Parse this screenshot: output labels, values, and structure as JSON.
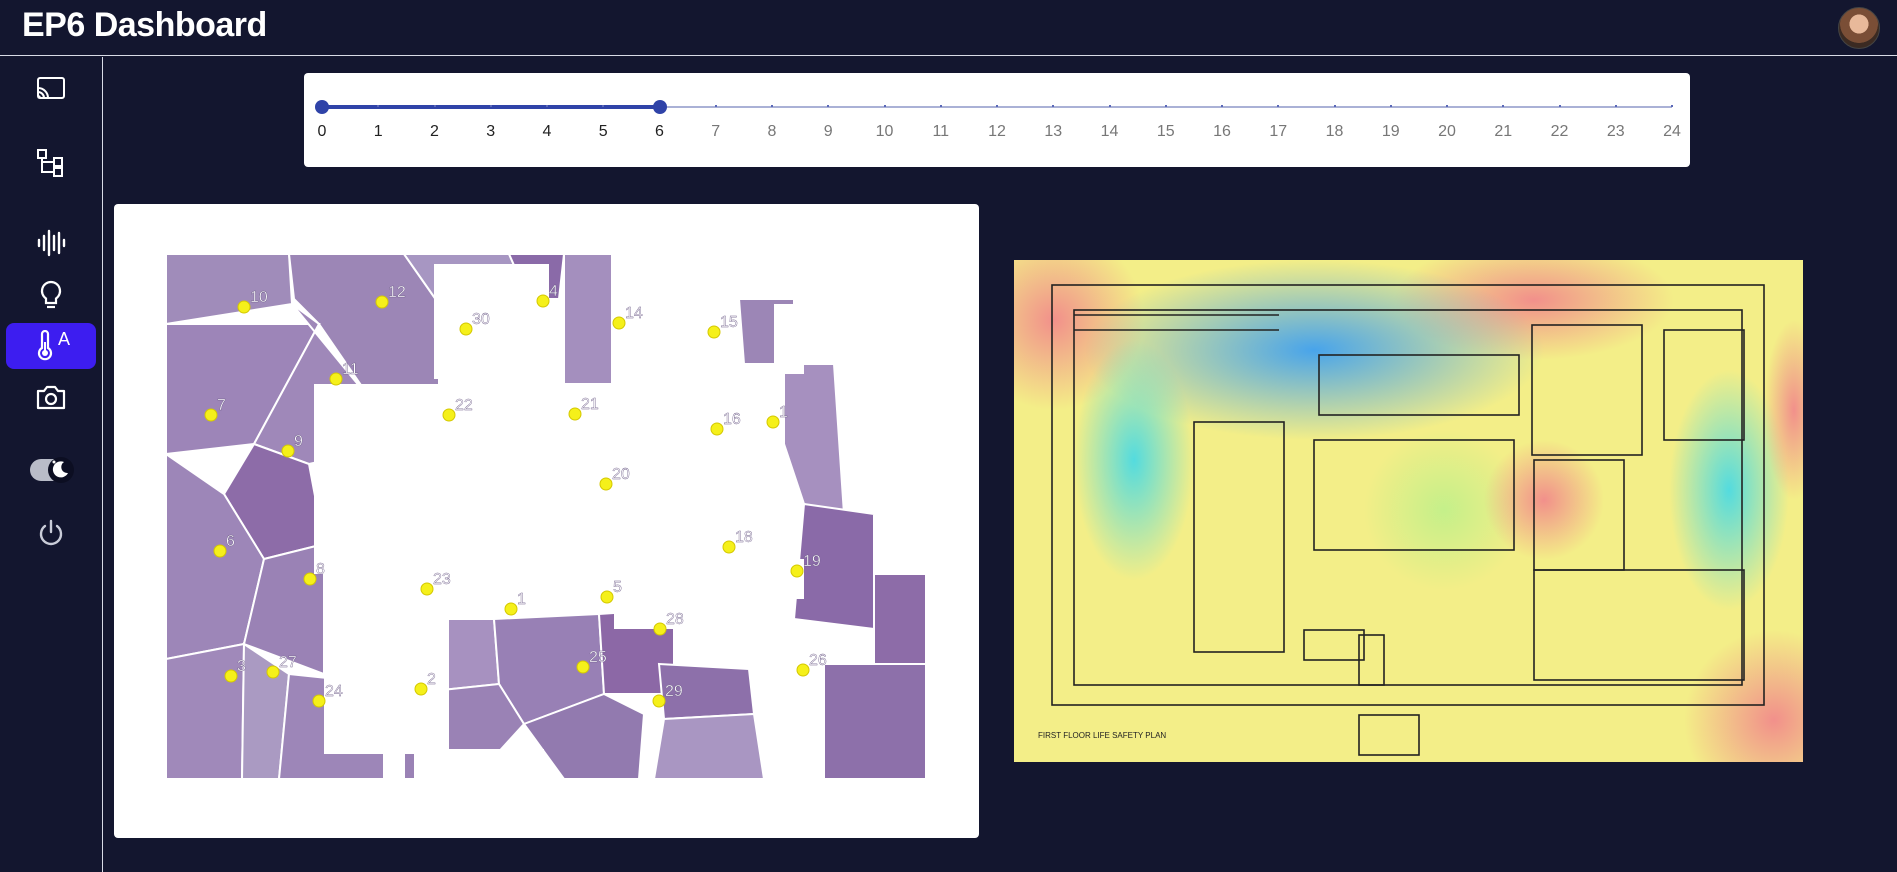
{
  "header": {
    "title": "EP6 Dashboard"
  },
  "sidebar": {
    "items": [
      {
        "name": "cast-icon"
      },
      {
        "name": "hierarchy-icon"
      },
      {
        "name": "waveform-icon"
      },
      {
        "name": "lightbulb-icon"
      },
      {
        "name": "temperature-icon",
        "label": "A",
        "active": true
      },
      {
        "name": "camera-icon"
      },
      {
        "name": "theme-toggle-icon"
      },
      {
        "name": "power-icon"
      }
    ]
  },
  "time_slider": {
    "min": 0,
    "max": 24,
    "selected_range": [
      0,
      6
    ],
    "labels": [
      "0",
      "1",
      "2",
      "3",
      "4",
      "5",
      "6",
      "7",
      "8",
      "9",
      "10",
      "11",
      "12",
      "13",
      "14",
      "15",
      "16",
      "17",
      "18",
      "19",
      "20",
      "21",
      "22",
      "23",
      "24"
    ]
  },
  "sensor_map": {
    "sensors": [
      "10",
      "12",
      "30",
      "4",
      "14",
      "15",
      "11",
      "7",
      "9",
      "22",
      "21",
      "16",
      "1",
      "20",
      "6",
      "8",
      "18",
      "19",
      "23",
      "1",
      "5",
      "28",
      "3",
      "27",
      "24",
      "2",
      "25",
      "26",
      "29"
    ]
  },
  "heatmap": {
    "plan_title": "FIRST FLOOR LIFE SAFETY PLAN"
  },
  "colors": {
    "accent": "#3d1df0",
    "slider": "#2f43a8",
    "background": "#13162f",
    "sensor": "#f5f01a"
  }
}
